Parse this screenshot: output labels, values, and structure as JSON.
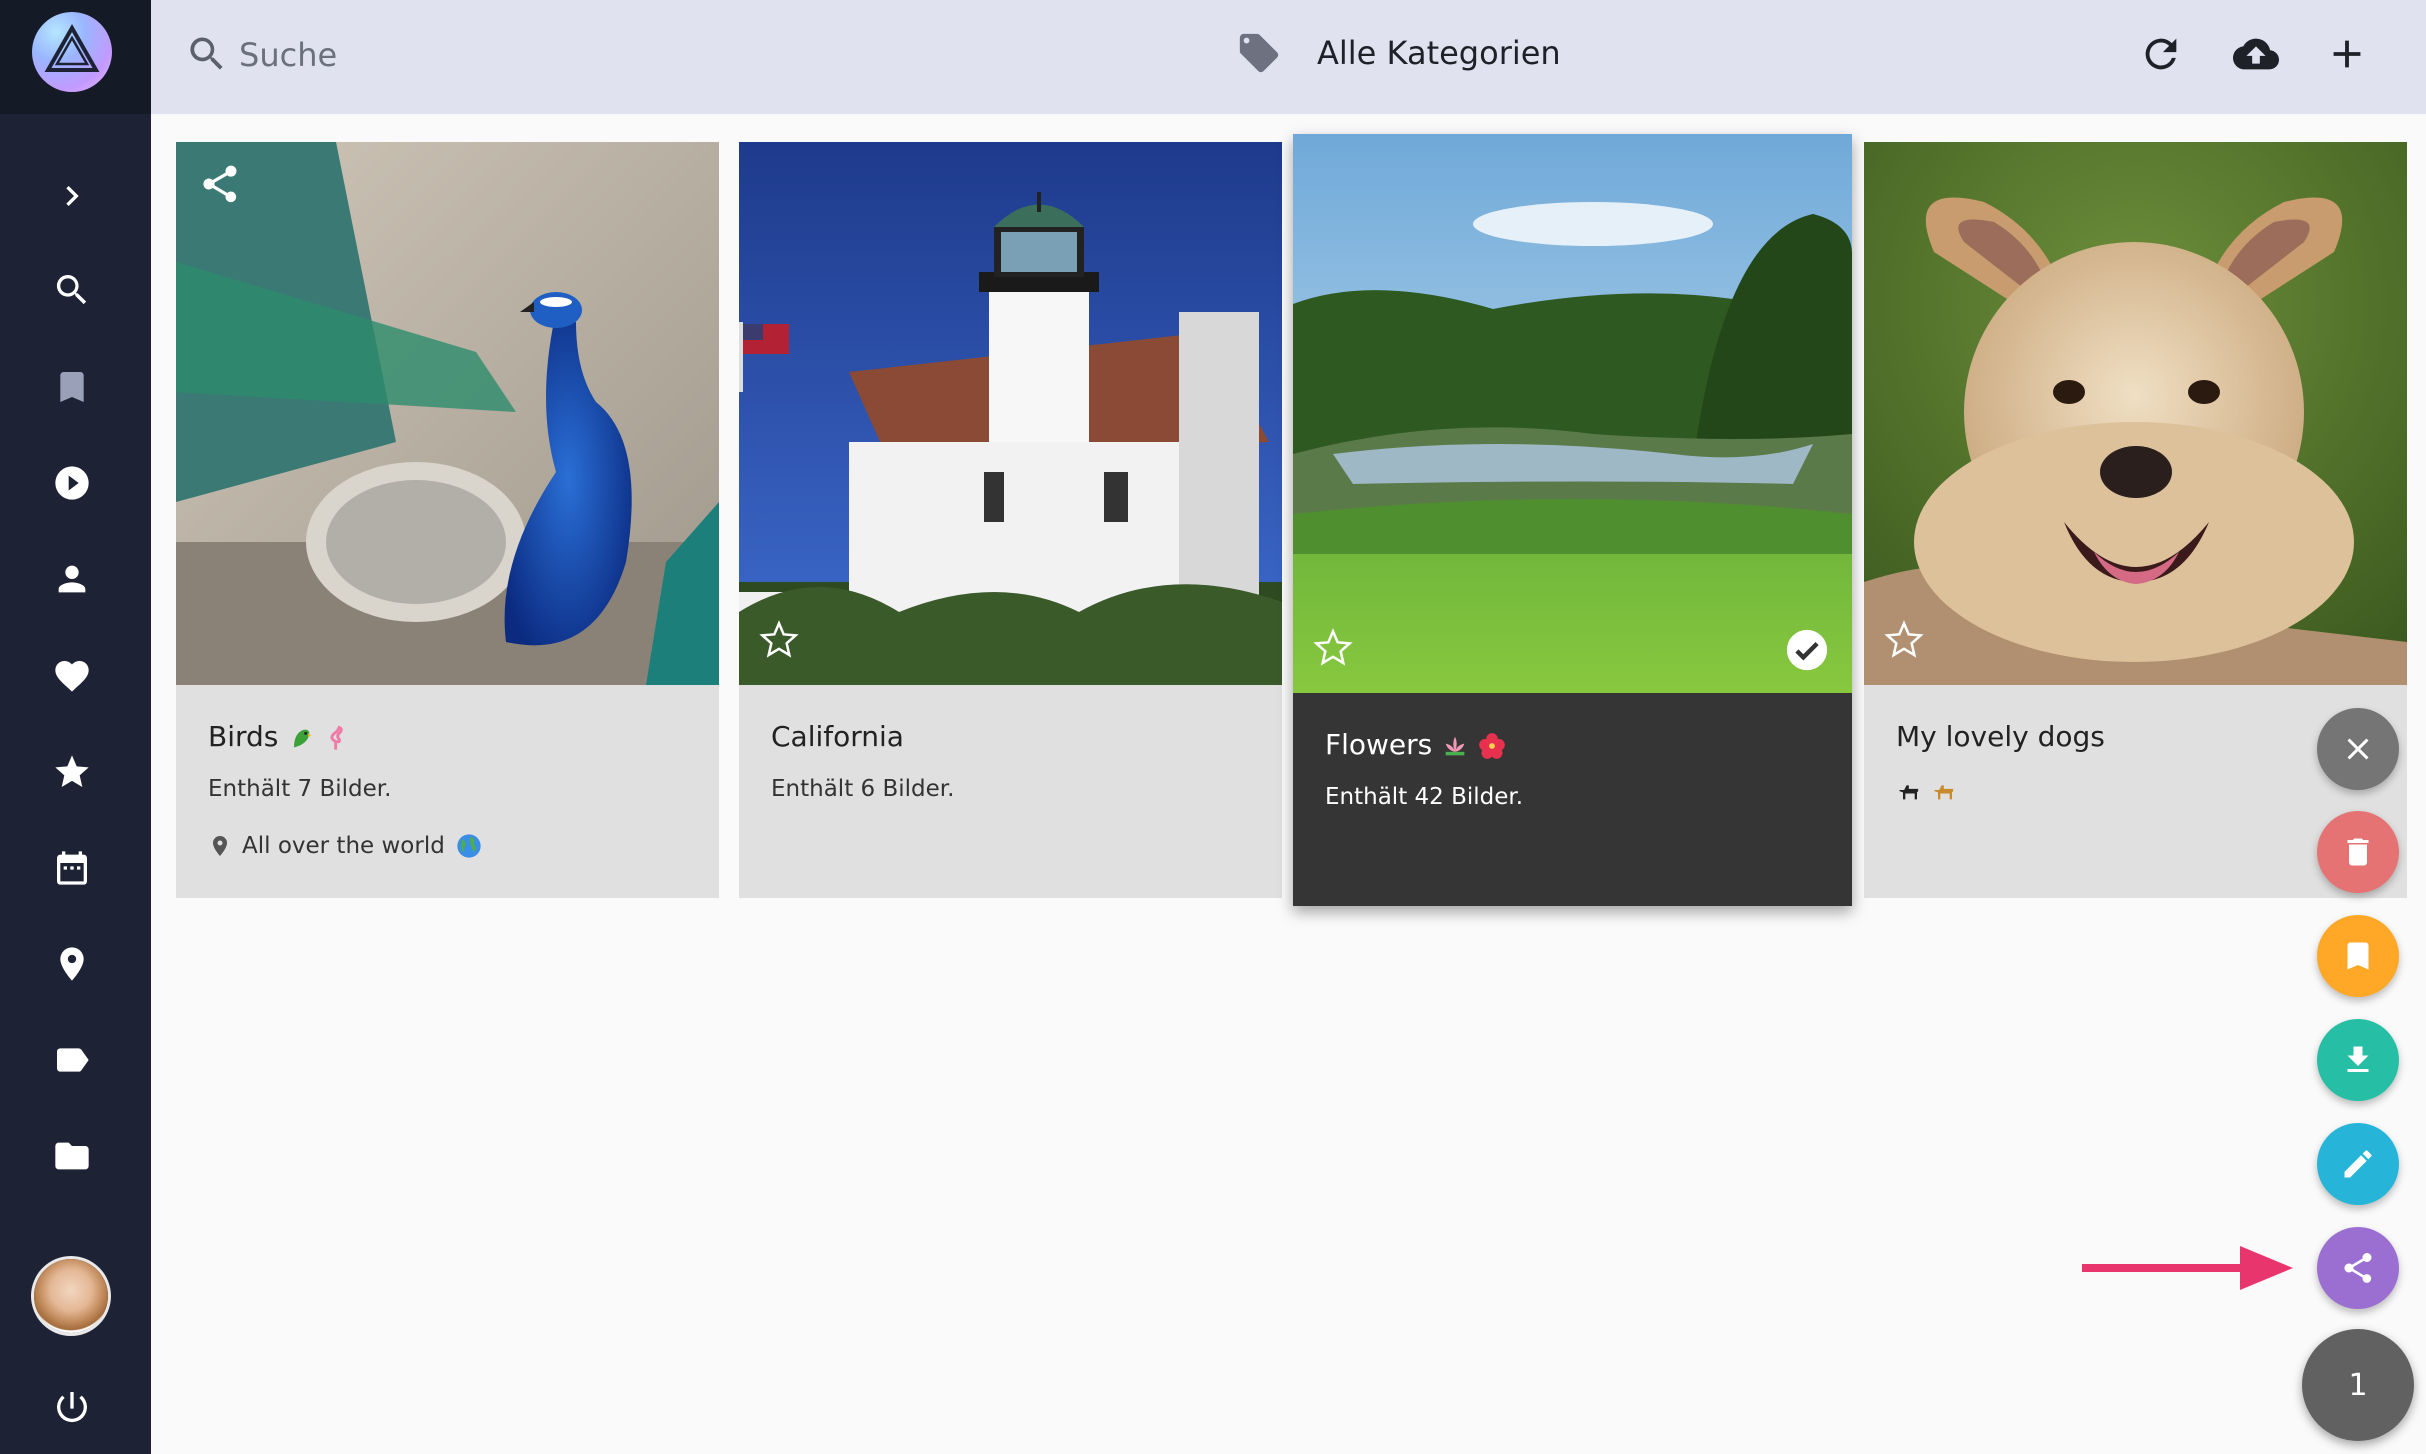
{
  "sidebar": {
    "nav_items": [
      {
        "name": "expand",
        "icon": "chevron-right-icon"
      },
      {
        "name": "search",
        "icon": "search-icon"
      },
      {
        "name": "bookmark",
        "icon": "bookmark-icon"
      },
      {
        "name": "videos",
        "icon": "play-circle-icon"
      },
      {
        "name": "people",
        "icon": "person-icon"
      },
      {
        "name": "favorites",
        "icon": "heart-icon"
      },
      {
        "name": "moments",
        "icon": "star-icon"
      },
      {
        "name": "calendar",
        "icon": "calendar-icon"
      },
      {
        "name": "places",
        "icon": "map-pin-icon"
      },
      {
        "name": "labels",
        "icon": "label-icon"
      },
      {
        "name": "folders",
        "icon": "folder-icon"
      },
      {
        "name": "logout",
        "icon": "power-icon"
      }
    ]
  },
  "toolbar": {
    "search_placeholder": "Suche",
    "category": "Alle Kategorien"
  },
  "albums": [
    {
      "title": "Birds",
      "count_text": "Enthält 7 Bilder.",
      "location": "All over the world",
      "selected": false
    },
    {
      "title": "California",
      "count_text": "Enthält 6 Bilder.",
      "selected": false
    },
    {
      "title": "Flowers",
      "count_text": "Enthält 42 Bilder.",
      "selected": true
    },
    {
      "title": "My lovely dogs",
      "selected": false
    }
  ],
  "fabs": [
    {
      "name": "close",
      "color": "#757575"
    },
    {
      "name": "delete",
      "color": "#e57373"
    },
    {
      "name": "bookmark",
      "color": "#ffa726"
    },
    {
      "name": "download",
      "color": "#26bfa6"
    },
    {
      "name": "edit",
      "color": "#26b5d9"
    },
    {
      "name": "share",
      "color": "#9b6fd1"
    }
  ],
  "selection_count": "1",
  "colors": {
    "sidebar": "#1d2334",
    "toolbar": "#e0e3ef",
    "arrow": "#e8356d"
  }
}
